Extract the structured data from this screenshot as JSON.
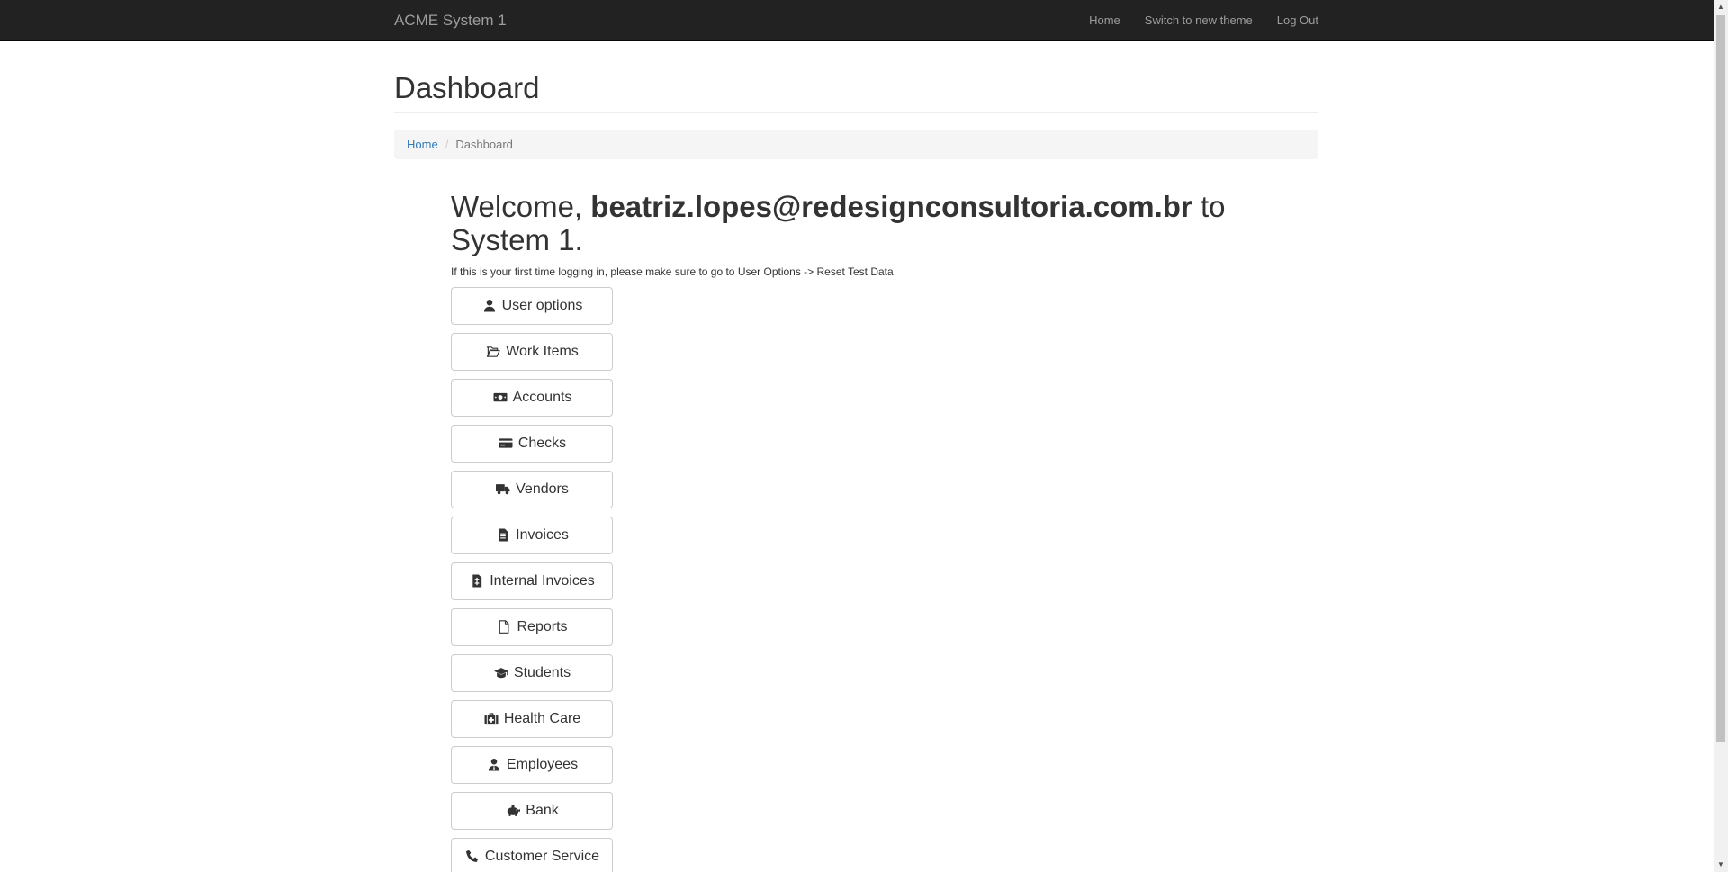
{
  "navbar": {
    "brand": "ACME System 1",
    "links": [
      "Home",
      "Switch to new theme",
      "Log Out"
    ]
  },
  "page": {
    "title": "Dashboard"
  },
  "breadcrumb": {
    "home": "Home",
    "current": "Dashboard"
  },
  "welcome": {
    "prefix": "Welcome, ",
    "email": "beatriz.lopes@redesignconsultoria.com.br",
    "suffix": " to System 1.",
    "hint": "If this is your first time logging in, please make sure to go to User Options -> Reset Test Data"
  },
  "buttons": [
    {
      "label": "User options",
      "icon": "user-icon"
    },
    {
      "label": "Work Items",
      "icon": "folder-open-icon"
    },
    {
      "label": "Accounts",
      "icon": "money-icon"
    },
    {
      "label": "Checks",
      "icon": "credit-card-icon"
    },
    {
      "label": "Vendors",
      "icon": "truck-icon"
    },
    {
      "label": "Invoices",
      "icon": "file-text-icon"
    },
    {
      "label": "Internal Invoices",
      "icon": "file-invoice-icon"
    },
    {
      "label": "Reports",
      "icon": "file-icon"
    },
    {
      "label": "Students",
      "icon": "graduation-cap-icon"
    },
    {
      "label": "Health Care",
      "icon": "medkit-icon"
    },
    {
      "label": "Employees",
      "icon": "user-tie-icon"
    },
    {
      "label": "Bank",
      "icon": "piggy-bank-icon"
    },
    {
      "label": "Customer Service",
      "icon": "phone-icon"
    }
  ]
}
